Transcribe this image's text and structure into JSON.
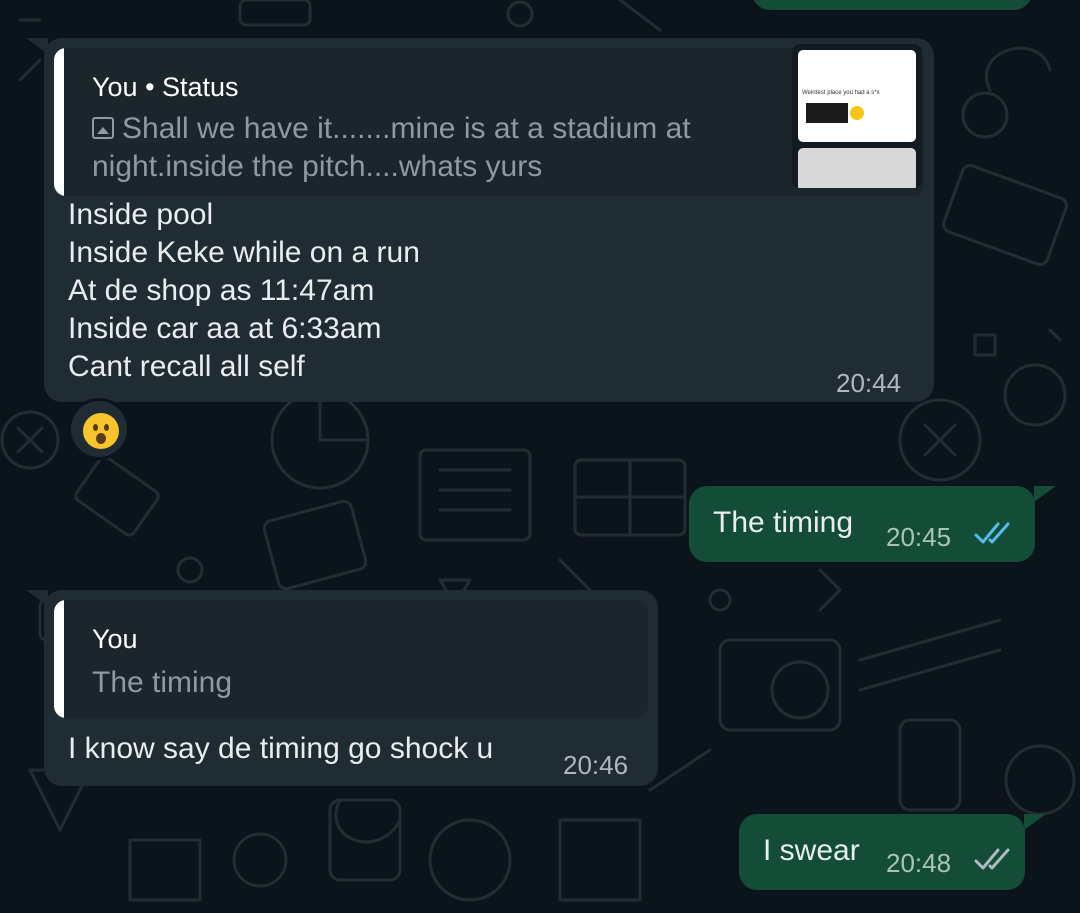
{
  "messages": {
    "incoming_status_reply": {
      "quote_author": "You • Status",
      "quote_line1": "Shall we have it.......mine is at a stadium at",
      "quote_line2": "night.inside the pitch....whats yurs",
      "thumb_icon": "status-image-thumbnail",
      "thumb_caption": "Weirdest place you had a s*x",
      "lines": [
        "Inside pool",
        "Inside Keke while on a run",
        "At de shop as 11:47am",
        "Inside car aa at 6:33am",
        "Cant recall all self"
      ],
      "time": "20:44",
      "reaction": "astonished-face-emoji"
    },
    "outgoing_1": {
      "text": "The timing",
      "time": "20:45",
      "status": "read",
      "tick_color": "#53bdeb"
    },
    "incoming_reply": {
      "quote_author": "You",
      "quote_text": "The timing",
      "text": "I know say de timing go shock u",
      "time": "20:46"
    },
    "outgoing_2": {
      "text": "I swear",
      "time": "20:48",
      "status": "delivered",
      "tick_color": "#aebac1"
    }
  },
  "colors": {
    "background": "#0b141a",
    "incoming_bubble": "#1f2c34",
    "outgoing_bubble": "#144d37"
  }
}
